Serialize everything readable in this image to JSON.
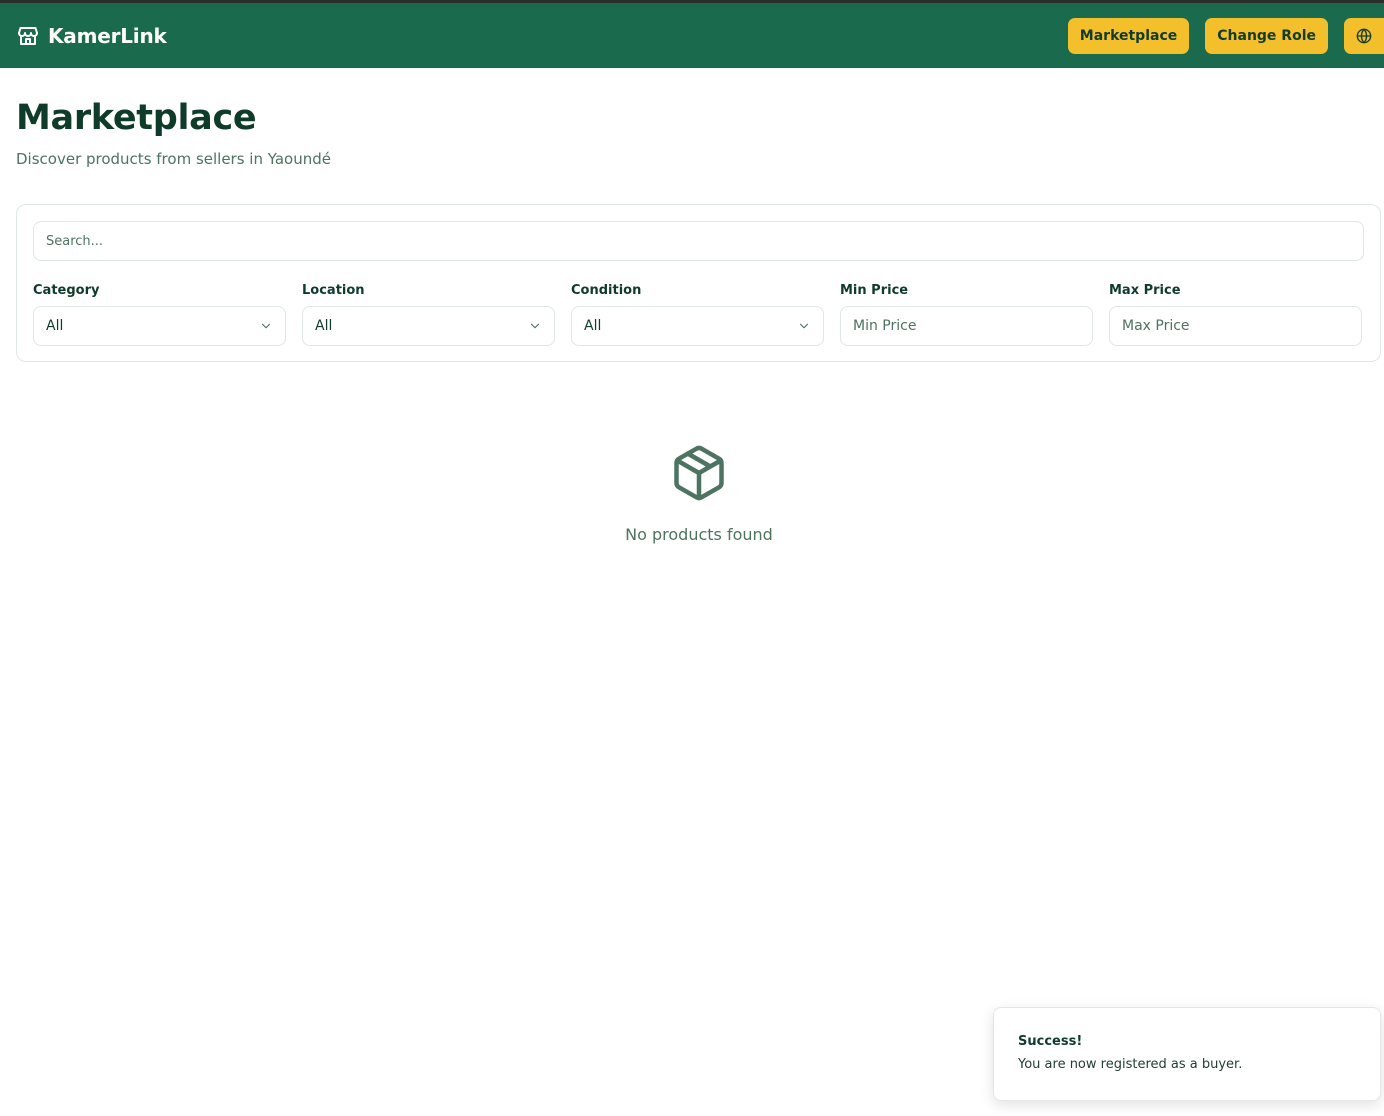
{
  "navbar": {
    "brand": "KamerLink",
    "brand_icon": "store-icon",
    "marketplace_label": "Marketplace",
    "change_role_label": "Change Role",
    "language_icon": "globe-icon"
  },
  "header": {
    "title": "Marketplace",
    "subtitle": "Discover products from sellers in Yaoundé"
  },
  "filters": {
    "search_placeholder": "Search...",
    "category": {
      "label": "Category",
      "value": "All"
    },
    "location": {
      "label": "Location",
      "value": "All"
    },
    "condition": {
      "label": "Condition",
      "value": "All"
    },
    "min_price": {
      "label": "Min Price",
      "placeholder": "Min Price"
    },
    "max_price": {
      "label": "Max Price",
      "placeholder": "Max Price"
    }
  },
  "empty_state": {
    "icon": "package-icon",
    "message": "No products found"
  },
  "toast": {
    "title": "Success!",
    "message": "You are now registered as a buyer."
  },
  "colors": {
    "navbar_bg": "#1a6b4e",
    "accent_button": "#f3bf2a",
    "text_primary": "#0f3b2a",
    "text_muted": "#4d7361"
  }
}
